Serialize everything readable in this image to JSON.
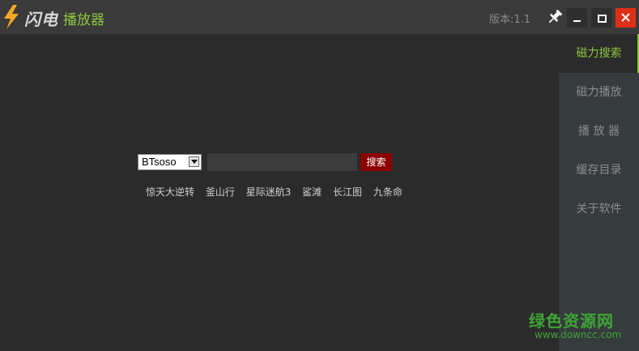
{
  "titlebar": {
    "brand": "闪电",
    "app_name": "播放器",
    "version": "版本:1.1",
    "colors": {
      "accent": "#8dc63f",
      "close": "#e02f17",
      "logo": "#f5a623"
    },
    "icons": [
      "lightning-logo-icon",
      "pin-icon",
      "minimize-icon",
      "maximize-icon",
      "close-icon"
    ]
  },
  "sidebar": {
    "items": [
      {
        "label": "磁力搜索",
        "active": true
      },
      {
        "label": "磁力播放",
        "active": false
      },
      {
        "label": "播 放 器",
        "active": false
      },
      {
        "label": "缓存目录",
        "active": false
      },
      {
        "label": "关于软件",
        "active": false
      }
    ]
  },
  "search": {
    "engine": "BTsoso",
    "query": "",
    "button_label": "搜索",
    "button_color": "#8b0000"
  },
  "hot_keywords": [
    "惊天大逆转",
    "釜山行",
    "星际迷航3",
    "鲨滩",
    "长江图",
    "九条命"
  ],
  "watermark": {
    "title": "绿色资源网",
    "url": "www.downcc.com"
  }
}
